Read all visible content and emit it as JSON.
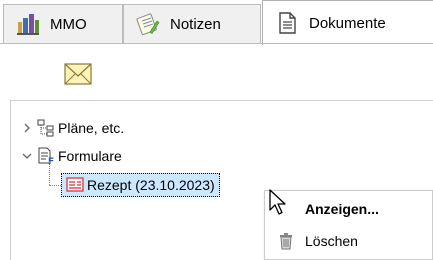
{
  "tabs": [
    {
      "label": "MMO",
      "icon": "building-chart-icon",
      "active": false
    },
    {
      "label": "Notizen",
      "icon": "notepad-pencil-icon",
      "active": false
    },
    {
      "label": "Dokumente",
      "icon": "document-icon",
      "active": true
    }
  ],
  "toolbar": {
    "mail_icon": "envelope-icon"
  },
  "tree": {
    "nodes": [
      {
        "label": "Pläne, etc.",
        "icon": "hierarchy-icon",
        "expanded": false
      },
      {
        "label": "Formulare",
        "icon": "form-icon",
        "expanded": true
      },
      {
        "label": "Rezept (23.10.2023)",
        "icon": "red-form-icon",
        "selected": true
      }
    ]
  },
  "context_menu": {
    "items": [
      {
        "label": "Anzeigen...",
        "default": true
      },
      {
        "label": "Löschen",
        "icon": "trash-icon"
      }
    ]
  },
  "colors": {
    "selection": "#cce8ff",
    "form_red": "#d9262e",
    "tab_bg": "#f0f0f0"
  }
}
